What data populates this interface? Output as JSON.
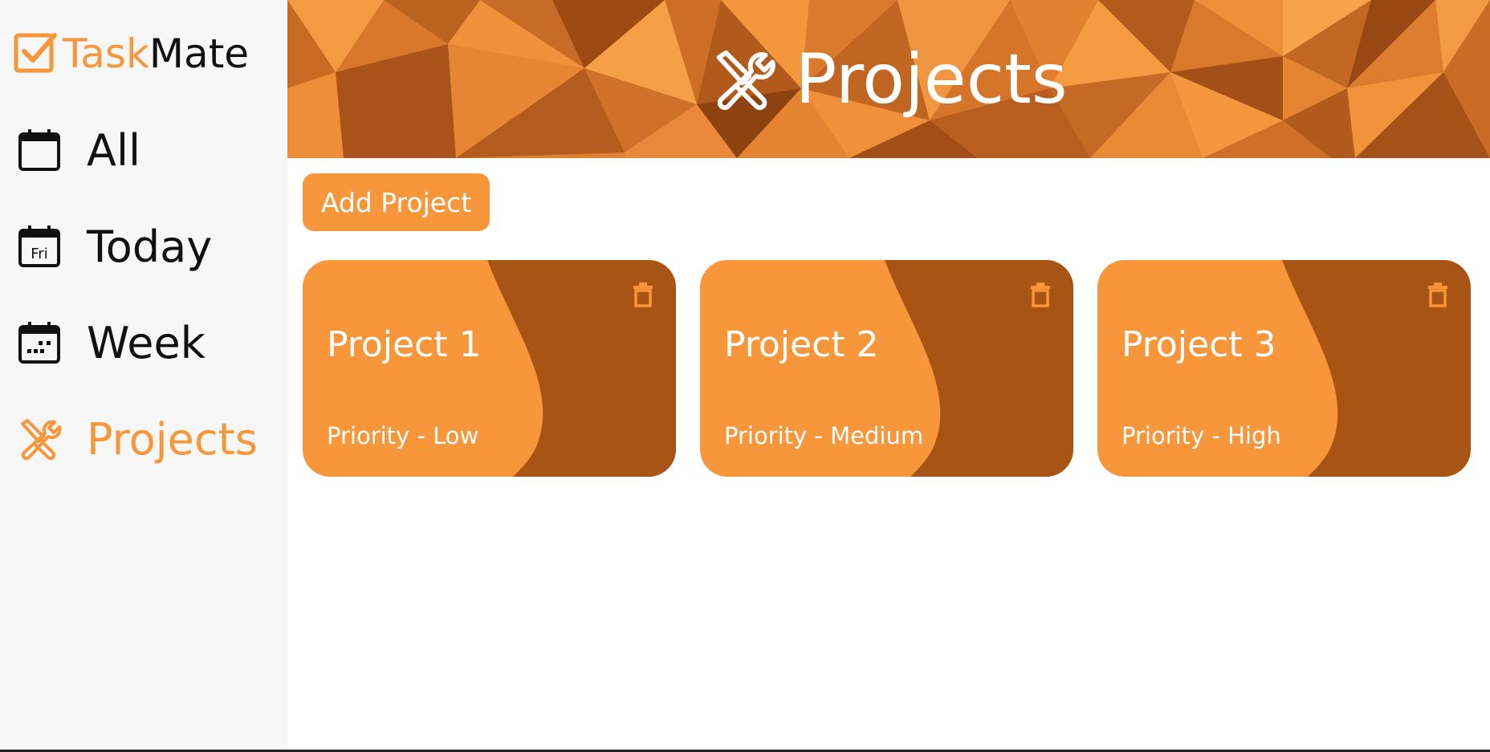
{
  "app": {
    "name_part1": "Task",
    "name_part2": "Mate"
  },
  "colors": {
    "accent": "#f7963a",
    "accent_dark": "#a85415",
    "sidebar_bg": "#f7f7f7"
  },
  "sidebar": {
    "items": [
      {
        "label": "All",
        "icon": "calendar-icon",
        "active": false
      },
      {
        "label": "Today",
        "icon": "calendar-day-icon",
        "icon_text": "Fri",
        "active": false
      },
      {
        "label": "Week",
        "icon": "calendar-week-icon",
        "active": false
      },
      {
        "label": "Projects",
        "icon": "tools-icon",
        "active": true
      }
    ]
  },
  "header": {
    "title": "Projects",
    "icon": "tools-icon"
  },
  "toolbar": {
    "add_label": "Add Project"
  },
  "projects": [
    {
      "title": "Project 1",
      "priority": "Priority - Low"
    },
    {
      "title": "Project 2",
      "priority": "Priority - Medium"
    },
    {
      "title": "Project 3",
      "priority": "Priority - High"
    }
  ]
}
